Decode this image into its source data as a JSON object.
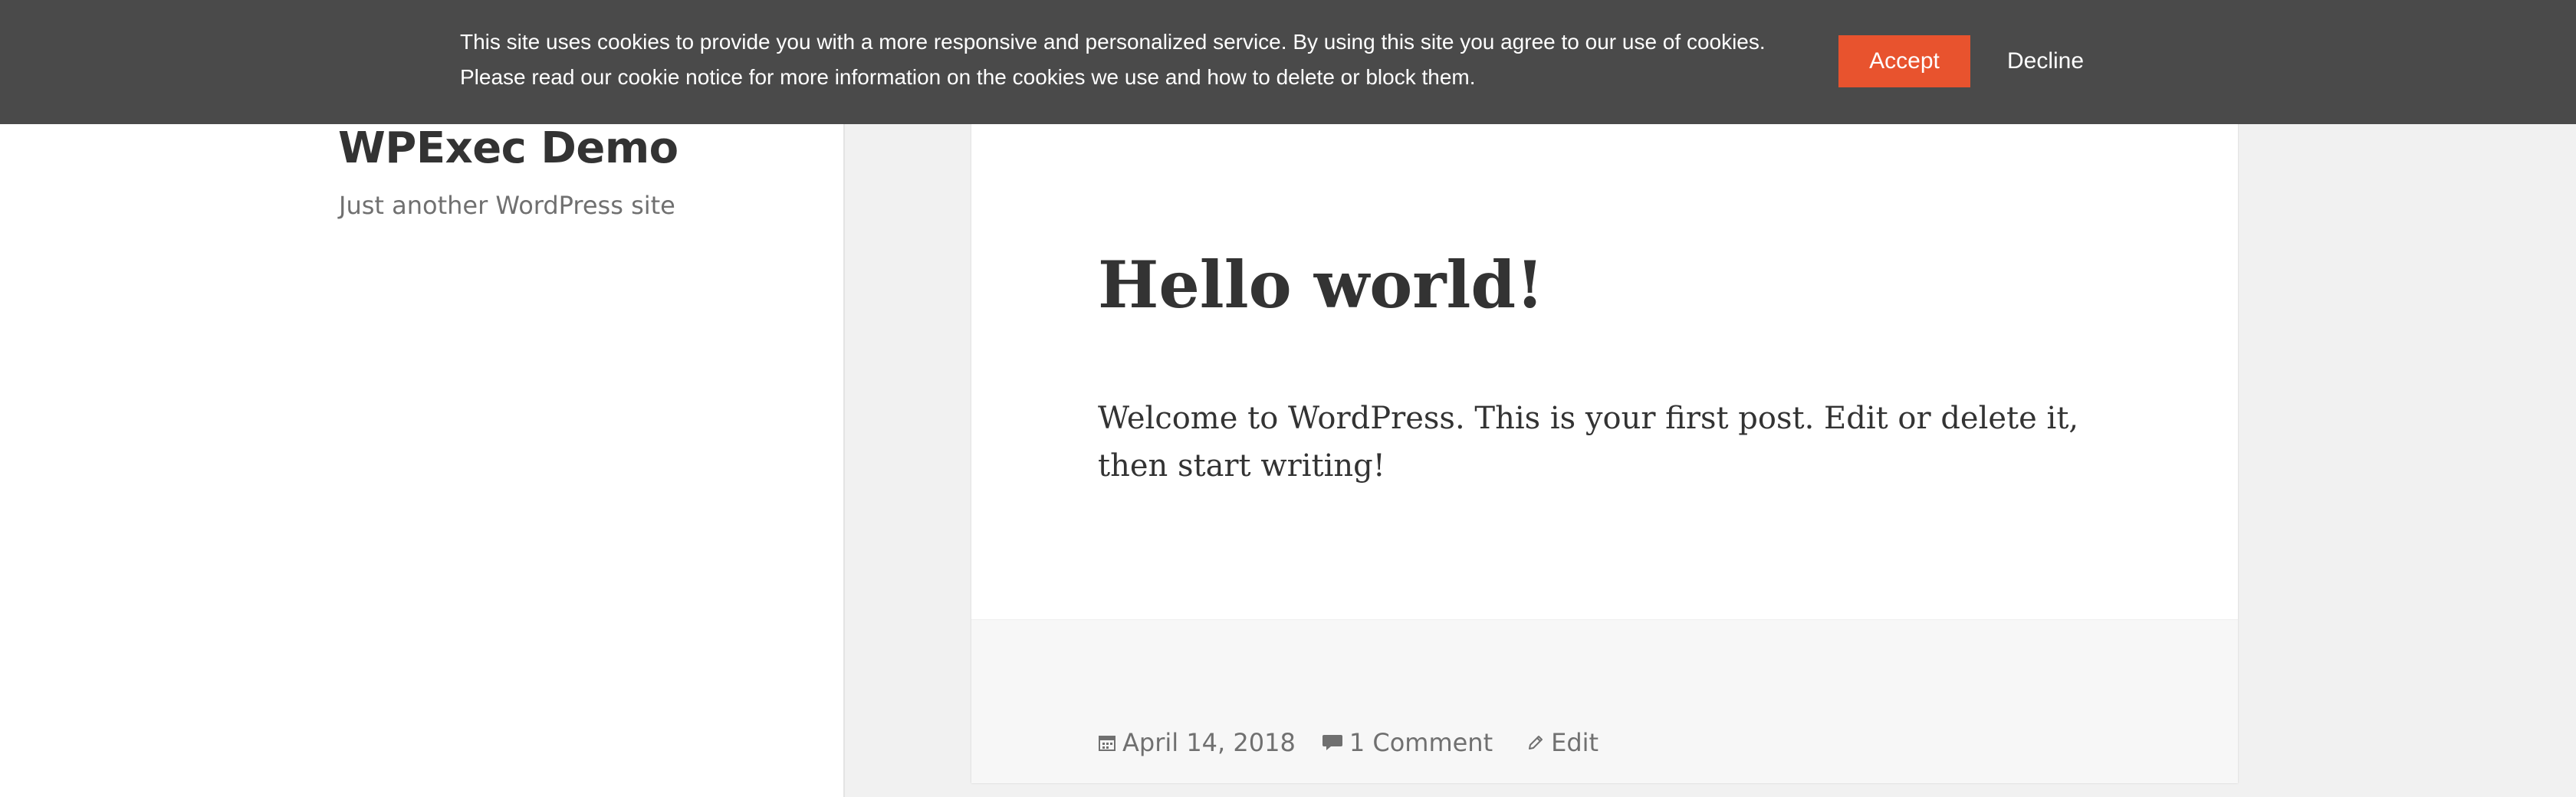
{
  "site": {
    "title": "WPExec Demo",
    "description": "Just another WordPress site"
  },
  "post": {
    "title": "Hello world!",
    "content": "Welcome to WordPress. This is your first post. Edit or delete it, then start writing!",
    "meta": {
      "date": "April 14, 2018",
      "comments": "1 Comment",
      "edit": "Edit",
      "date_icon": "calendar-icon",
      "comments_icon": "comment-icon",
      "edit_icon": "pencil-icon"
    }
  },
  "cookie_banner": {
    "line1": "This site uses cookies to provide you with a more responsive and personalized service. By using this site you agree to our use of cookies.",
    "line2": "Please read our cookie notice for more information on the cookies we use and how to delete or block them.",
    "accept_label": "Accept",
    "decline_label": "Decline",
    "accept_color": "#e8532e",
    "background_color": "#4a4a4a"
  }
}
